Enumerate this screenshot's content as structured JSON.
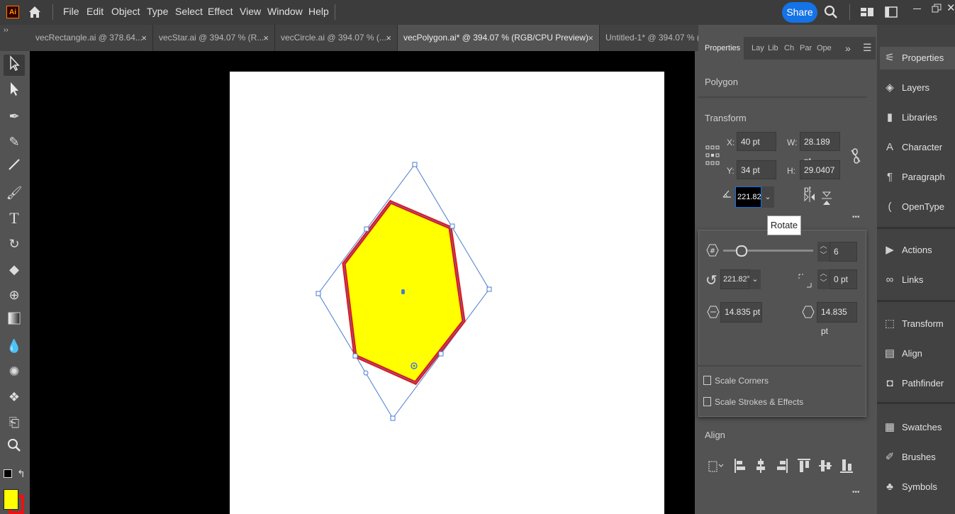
{
  "app": {
    "logo": "Ai"
  },
  "menu": [
    "File",
    "Edit",
    "Object",
    "Type",
    "Select",
    "Effect",
    "View",
    "Window",
    "Help"
  ],
  "share_label": "Share",
  "tabs": [
    {
      "label": "vecRectangle.ai @ 378.64...",
      "close": "×"
    },
    {
      "label": "vecStar.ai @ 394.07 % (R...",
      "close": "×"
    },
    {
      "label": "vecCircle.ai @ 394.07 % (...",
      "close": "×"
    },
    {
      "label": "vecPolygon.ai* @ 394.07 % (RGB/CPU Preview)",
      "close": "×"
    },
    {
      "label": "Untitled-1* @ 394.07 % (",
      "close": ""
    }
  ],
  "properties": {
    "tabs": [
      "Properties",
      "Lay",
      "Lib",
      "Ch",
      "Par",
      "Ope"
    ],
    "overflow": "»",
    "object_type": "Polygon",
    "transform_title": "Transform",
    "x_label": "X:",
    "x_value": "40 pt",
    "y_label": "Y:",
    "y_value": "34 pt",
    "w_label": "W:",
    "w_value": "28.189 pt",
    "h_label": "H:",
    "h_value": "29.0407 pt",
    "rotate_value": "221.821",
    "tooltip": "Rotate",
    "align_title": "Align",
    "more": "•••"
  },
  "polygon_options": {
    "sides_value": "6",
    "angle_value": "221.82°",
    "corner_value": "0 pt",
    "radius_value": "14.835 pt",
    "side_length_value": "14.835 pt",
    "scale_corners_label": "Scale Corners",
    "scale_strokes_label": "Scale Strokes & Effects"
  },
  "colors": {
    "fill": "#ffff00",
    "stroke": "#ee1111",
    "selection": "#4a7bd0"
  },
  "dock": [
    "Properties",
    "Layers",
    "Libraries",
    "Character",
    "Paragraph",
    "OpenType",
    "Actions",
    "Links",
    "Transform",
    "Align",
    "Pathfinder",
    "Swatches",
    "Brushes",
    "Symbols"
  ]
}
